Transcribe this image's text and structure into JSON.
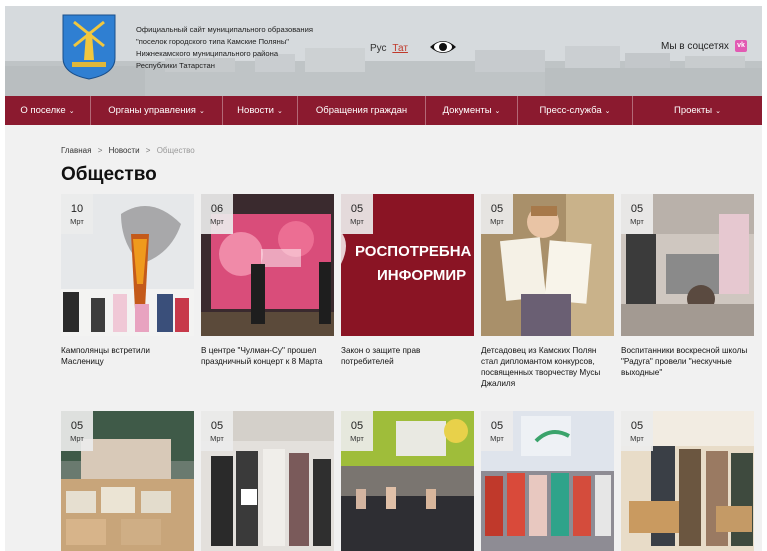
{
  "header": {
    "title_lines": [
      "Официальный сайт муниципального образования",
      "\"поселок городского типа Камские Поляны\"",
      "Нижнекамского муниципального района",
      "Республики Татарстан"
    ],
    "lang_ru": "Рус",
    "lang_tt": "Тат",
    "social_label": "Мы в соцсетях",
    "vk_label": "vk"
  },
  "nav": {
    "items": [
      {
        "label": "О поселке",
        "has_dropdown": true
      },
      {
        "label": "Органы управления",
        "has_dropdown": true
      },
      {
        "label": "Новости",
        "has_dropdown": true
      },
      {
        "label": "Обращения граждан",
        "has_dropdown": false
      },
      {
        "label": "Документы",
        "has_dropdown": true
      },
      {
        "label": "Пресс-служба",
        "has_dropdown": true
      },
      {
        "label": "Проекты",
        "has_dropdown": true
      }
    ],
    "chevron": "⌄"
  },
  "breadcrumb": {
    "home": "Главная",
    "news": "Новости",
    "current": "Общество",
    "separator": ">"
  },
  "page_title": "Общество",
  "banner_text": [
    "РОСПОТРЕБНА",
    "ИНФОРМИР"
  ],
  "cards": [
    {
      "day": "10",
      "month": "Мрт",
      "caption": "Камполянцы встретили Масленицу"
    },
    {
      "day": "06",
      "month": "Мрт",
      "caption": "В центре \"Чулман-Су\" прошел праздничный концерт к 8 Марта"
    },
    {
      "day": "05",
      "month": "Мрт",
      "caption": "Закон о защите прав потребителей"
    },
    {
      "day": "05",
      "month": "Мрт",
      "caption": "Детсадовец из Камских Полян стал дипломантом конкурсов, посвященных творчеству Мусы Джалиля"
    },
    {
      "day": "05",
      "month": "Мрт",
      "caption": "Воспитанники воскресной школы \"Радуга\" провели \"нескучные выходные\""
    },
    {
      "day": "05",
      "month": "Мрт",
      "caption": ""
    },
    {
      "day": "05",
      "month": "Мрт",
      "caption": ""
    },
    {
      "day": "05",
      "month": "Мрт",
      "caption": ""
    },
    {
      "day": "05",
      "month": "Мрт",
      "caption": ""
    },
    {
      "day": "05",
      "month": "Мрт",
      "caption": ""
    }
  ],
  "colors": {
    "nav_bg": "#8b1a2f",
    "banner_bg": "#8a1424",
    "lang_active": "#c0392b",
    "vk_badge": "#e25bb3"
  },
  "icons": {
    "eye": "eye-icon",
    "emblem": "coat-of-arms-icon",
    "vk": "vk-icon"
  }
}
